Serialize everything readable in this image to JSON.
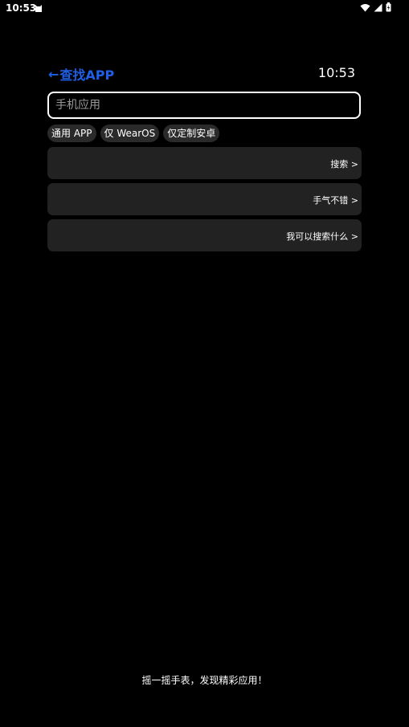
{
  "status_bar": {
    "time": "10:53",
    "icons": [
      "wifi-icon",
      "signal-icon",
      "battery-charging-icon"
    ]
  },
  "header": {
    "back_arrow": "←",
    "title": "查找APP",
    "clock": "10:53",
    "accent_color": "#1f5fe6"
  },
  "search": {
    "placeholder": "手机应用",
    "value": ""
  },
  "filters": [
    {
      "label": "通用 APP"
    },
    {
      "label": "仅 WearOS"
    },
    {
      "label": "仅定制安卓"
    }
  ],
  "actions": [
    {
      "label": "搜索 >"
    },
    {
      "label": "手气不错 >"
    },
    {
      "label": "我可以搜索什么 >"
    }
  ],
  "footer": {
    "text": "摇一摇手表，发现精彩应用！"
  }
}
